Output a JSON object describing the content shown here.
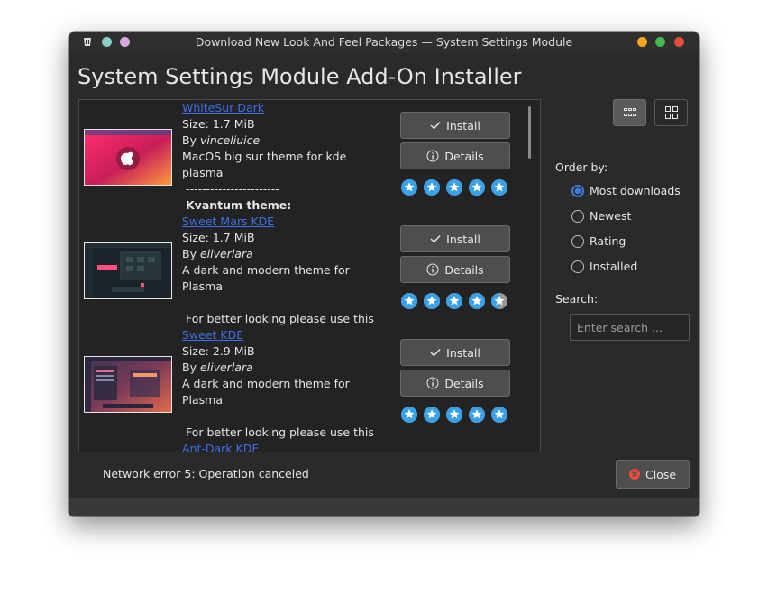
{
  "window": {
    "title": "Download New Look And Feel Packages — System Settings Module",
    "controls": {
      "minimize_color": "#f3a81a",
      "maximize_color": "#3fb950",
      "close_color": "#e74c3c"
    }
  },
  "heading": "System Settings Module Add-On Installer",
  "items": [
    {
      "name": "WhiteSur Dark",
      "size": "Size: 1.7 MiB",
      "by_prefix": "By ",
      "author": "vinceliuice",
      "desc_lines": [
        "MacOS big sur theme for kde",
        "plasma"
      ],
      "extra_lines": [
        "-----------------------",
        "Kvantum theme:"
      ],
      "install_label": "Install",
      "details_label": "Details",
      "rating": 5
    },
    {
      "name": "Sweet Mars KDE",
      "size": "Size: 1.7 MiB",
      "by_prefix": "By ",
      "author": "eliverlara",
      "desc_lines": [
        "A dark and modern theme for",
        "Plasma"
      ],
      "extra_lines": [
        "",
        "For better looking please use this"
      ],
      "install_label": "Install",
      "details_label": "Details",
      "rating": 4.5
    },
    {
      "name": "Sweet KDE",
      "size": "Size: 2.9 MiB",
      "by_prefix": "By ",
      "author": "eliverlara",
      "desc_lines": [
        "A dark and modern theme for",
        "Plasma"
      ],
      "extra_lines": [
        "",
        "For better looking please use this"
      ],
      "install_label": "Install",
      "details_label": "Details",
      "rating": 5
    },
    {
      "name": "Ant-Dark KDE"
    }
  ],
  "sidebar": {
    "order_label": "Order by:",
    "order_options": [
      "Most downloads",
      "Newest",
      "Rating",
      "Installed"
    ],
    "selected_order": "Most downloads",
    "search_label": "Search:",
    "search_placeholder": "Enter search ...",
    "view_modes": [
      "list-view-icon",
      "grid-view-icon"
    ],
    "active_view": "list-view-icon"
  },
  "status": "Network error 5: Operation canceled",
  "close_label": "Close",
  "colors": {
    "link": "#3f6ee6",
    "star": "#3aa0e8",
    "accent": "#3d7bd9",
    "close_icon": "#e74c3c"
  }
}
